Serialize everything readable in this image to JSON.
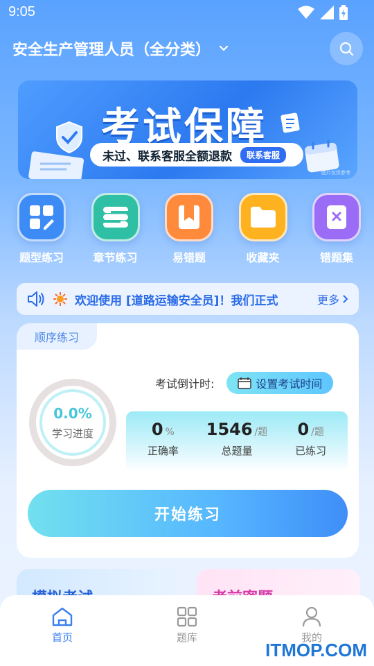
{
  "status_bar": {
    "time": "9:05"
  },
  "header": {
    "title": "安全生产管理人员（全分类）"
  },
  "banner": {
    "headline": "考试保障",
    "subline": "未过、联系客服全额退款",
    "tag": "联系客服",
    "credit": "图片仅供参考"
  },
  "quick_nav": [
    {
      "label": "题型练习",
      "icon": "grid-edit-icon",
      "color": "#3d8cf5"
    },
    {
      "label": "章节练习",
      "icon": "chapter-s-icon",
      "color": "#2fbfa4"
    },
    {
      "label": "易错题",
      "icon": "bookmark-icon",
      "color": "#ff8a3c"
    },
    {
      "label": "收藏夹",
      "icon": "folder-icon",
      "color": "#ffb21f"
    },
    {
      "label": "错题集",
      "icon": "wrong-book-icon",
      "color": "#9b6cf5"
    }
  ],
  "notice": {
    "text": "欢迎使用 [道路运输安全员]！我们正式",
    "more": "更多"
  },
  "practice_card": {
    "tab": "顺序练习",
    "progress_value": "0.0%",
    "progress_label": "学习进度",
    "countdown_label": "考试倒计时:",
    "set_time_button": "设置考试时间",
    "stats": [
      {
        "value": "0",
        "unit": "%",
        "name": "正确率"
      },
      {
        "value": "1546",
        "unit": "/题",
        "name": "总题量"
      },
      {
        "value": "0",
        "unit": "/题",
        "name": "已练习"
      }
    ],
    "start_button": "开始练习"
  },
  "lower_cards": [
    {
      "title": "模拟考试"
    },
    {
      "title": "考前密题"
    }
  ],
  "tab_bar": [
    {
      "label": "首页",
      "active": true
    },
    {
      "label": "题库",
      "active": false
    },
    {
      "label": "我的",
      "active": false
    }
  ],
  "watermark": "ITMOP.COM"
}
